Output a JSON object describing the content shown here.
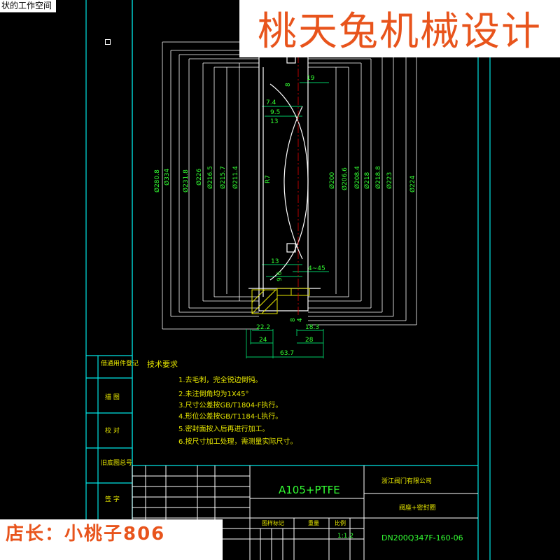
{
  "workspace_label": "状的工作空间",
  "banner": {
    "text": "桃天兔机械设计",
    "color": "#e8541c"
  },
  "owner": {
    "text": "店长：小桃子806",
    "color": "#e8541c"
  },
  "colors": {
    "background": "#000000",
    "frame": "#00e5e5",
    "dimension": "#00cc66",
    "outline": "#ffffff",
    "text_green": "#33ff33",
    "text_yellow": "#e6e600",
    "centerline": "#e00000"
  },
  "dimensions": {
    "left": [
      "Ø334",
      "Ø231.8",
      "Ø226",
      "Ø216.5",
      "Ø215.7",
      "Ø211.4"
    ],
    "left_extra": [
      "Ø280.8"
    ],
    "right": [
      "Ø200",
      "Ø206.6",
      "Ø208.4",
      "Ø218",
      "Ø218.8",
      "Ø223",
      "Ø224"
    ],
    "top": [
      "19",
      "8"
    ],
    "mid_left": [
      "7.4",
      "9.5",
      "13"
    ],
    "radius": "R7",
    "bottom_small": [
      "13",
      "9.6",
      "4~45"
    ],
    "bottom": [
      "22.2",
      "24",
      "18.3",
      "28",
      "63.7",
      "8",
      "4"
    ]
  },
  "tech_requirements": {
    "title": "技术要求",
    "items": [
      "1.去毛刺，完全锐边倒钝。",
      "2.未注倒角均为1X45°",
      "3.尺寸公差按GB/T1804-F执行。",
      "4.形位公差按GB/T1184-L执行。",
      "5.密封面按入后再进行加工。",
      "6.按尺寸加工处理，需测量实际尺寸。"
    ]
  },
  "left_table": [
    "借通用件登记",
    "描  图",
    "校  对",
    "旧底图总号",
    "签  字"
  ],
  "title_block": {
    "material": "A105+PTFE",
    "company": "浙江阀门有限公司",
    "part_name": "阀座+密封圈",
    "drawing_no": "DN200Q347F-160-06",
    "stage_label": "图样标记",
    "weight_label": "重量",
    "scale_label": "比例",
    "scale_value": "1:1.2"
  }
}
